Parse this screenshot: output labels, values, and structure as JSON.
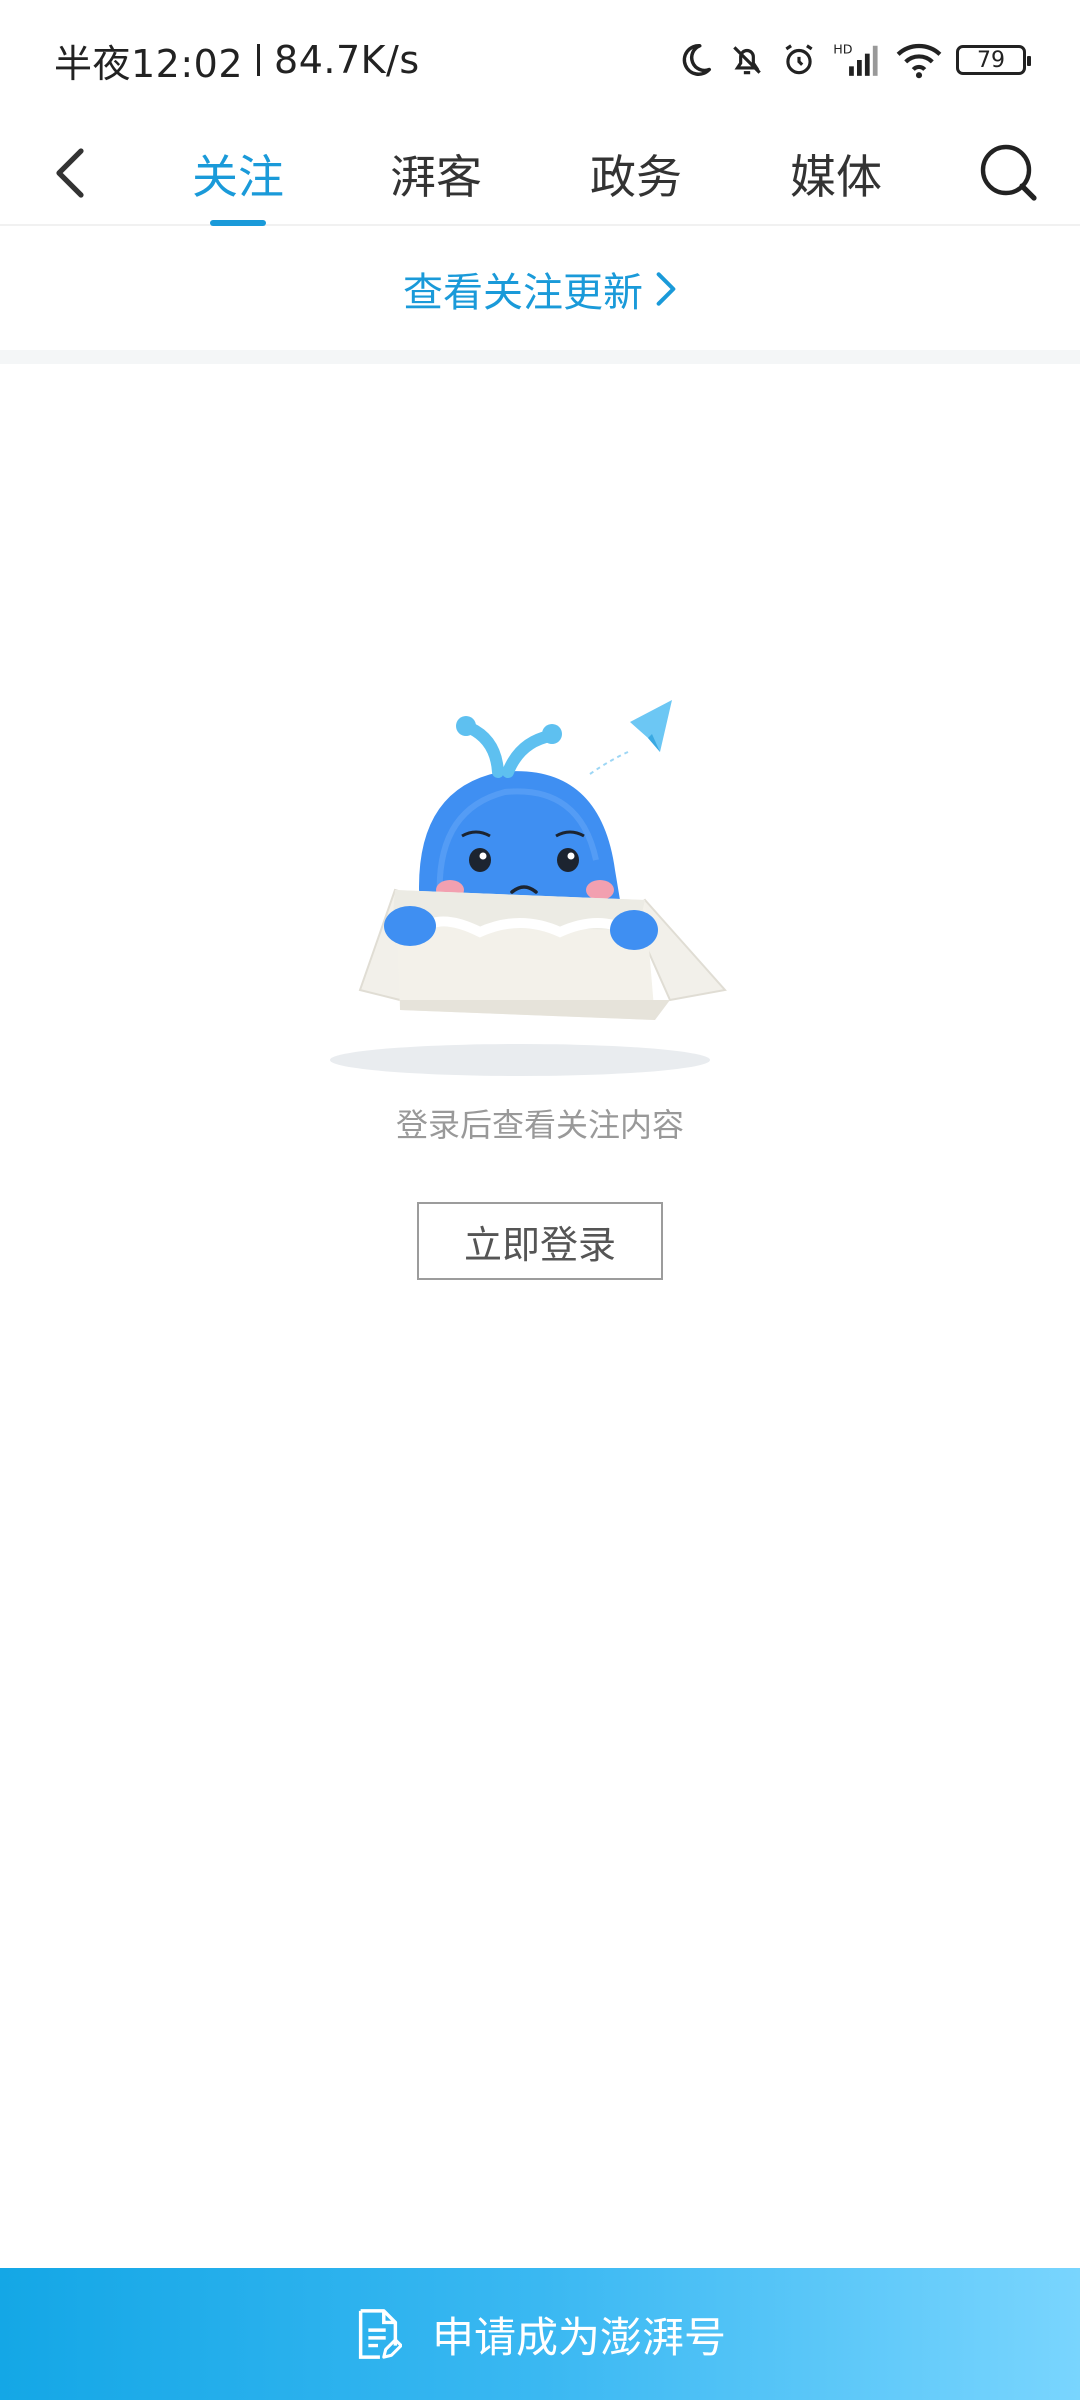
{
  "status_bar": {
    "time": "半夜12:02",
    "speed": "84.7K/s",
    "battery": "79"
  },
  "nav": {
    "tabs": [
      {
        "label": "关注",
        "active": true
      },
      {
        "label": "湃客",
        "active": false
      },
      {
        "label": "政务",
        "active": false
      },
      {
        "label": "媒体",
        "active": false
      }
    ],
    "back_icon": "chevron-left-icon",
    "search_icon": "search-icon"
  },
  "updates_link": {
    "label": "查看关注更新"
  },
  "empty_state": {
    "message": "登录后查看关注内容",
    "login_button": "立即登录",
    "illustration": "sad-whale-in-box"
  },
  "bottom_bar": {
    "label": "申请成为澎湃号",
    "icon": "document-edit-icon"
  },
  "colors": {
    "accent": "#1a9ad9",
    "bottom_start": "#14a7e6",
    "bottom_end": "#79d5fe"
  }
}
